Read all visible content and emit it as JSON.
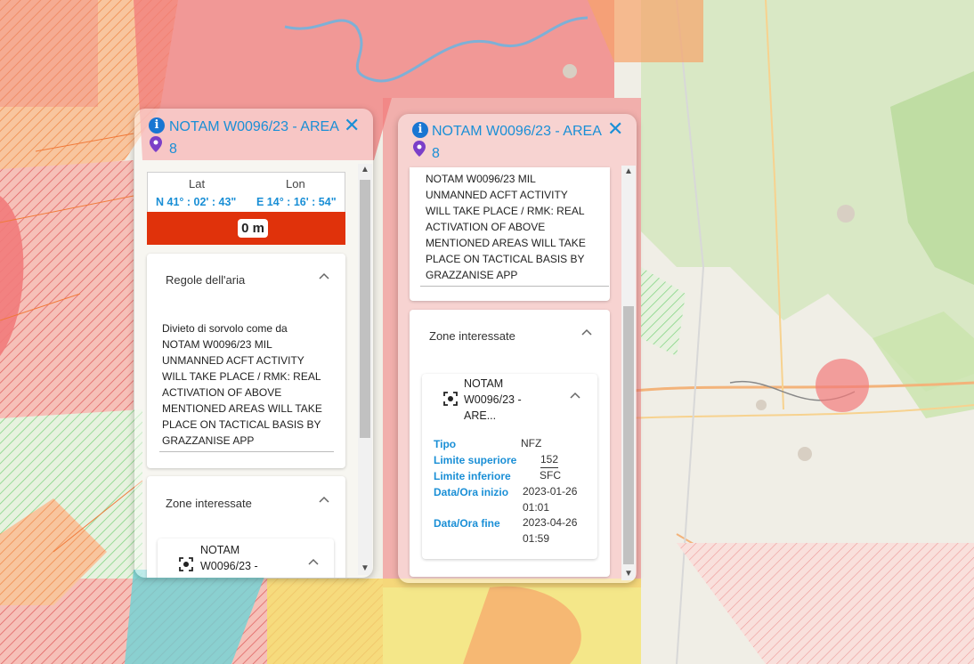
{
  "colors": {
    "accent": "#1a8fd6",
    "alt_bar": "#e0320b",
    "zone_red": "#f27b7b",
    "zone_orange": "#f6a46a",
    "zone_green": "#7fd37f",
    "zone_yellow": "#f5e46a",
    "zone_cyan": "#6fd3d6"
  },
  "popup_left": {
    "title": "NOTAM W0096/23 - AREA",
    "number": "8",
    "info_icon": "info-icon",
    "pin_icon": "map-pin-icon",
    "close_icon": "close-icon",
    "coords": {
      "lat_label": "Lat",
      "lon_label": "Lon",
      "lat_value": "N 41° : 02' : 43\"",
      "lon_value": "E 14° : 16' : 54\""
    },
    "altitude": "0 m",
    "section_rules": {
      "title": "Regole dell'aria",
      "text": [
        "Divieto di sorvolo come da",
        "NOTAM W0096/23 MIL",
        "UNMANNED ACFT ACTIVITY",
        "WILL TAKE PLACE / RMK: REAL",
        "ACTIVATION OF ABOVE",
        "MENTIONED AREAS WILL TAKE",
        "PLACE ON TACTICAL BASIS BY",
        "GRAZZANISE APP"
      ]
    },
    "section_zones": {
      "title": "Zone interessate",
      "item_lines": [
        "NOTAM",
        "W0096/23 -"
      ]
    }
  },
  "popup_right": {
    "title": "NOTAM W0096/23 - AREA",
    "number": "8",
    "text": [
      "NOTAM W0096/23 MIL",
      "UNMANNED ACFT ACTIVITY",
      "WILL TAKE PLACE / RMK: REAL",
      "ACTIVATION OF ABOVE",
      "MENTIONED AREAS WILL TAKE",
      "PLACE ON TACTICAL BASIS BY",
      "GRAZZANISE APP"
    ],
    "section_zones": {
      "title": "Zone interessate",
      "item_lines": [
        "NOTAM",
        "W0096/23 -",
        "ARE..."
      ],
      "details": {
        "tipo_label": "Tipo",
        "tipo": "NFZ",
        "sup_label": "Limite superiore",
        "sup": "152",
        "inf_label": "Limite inferiore",
        "inf": "SFC",
        "start_label": "Data/Ora inizio",
        "start_date": "2023-01-26",
        "start_time": "01:01",
        "end_label": "Data/Ora fine",
        "end_date": "2023-04-26",
        "end_time": "01:59"
      }
    }
  }
}
